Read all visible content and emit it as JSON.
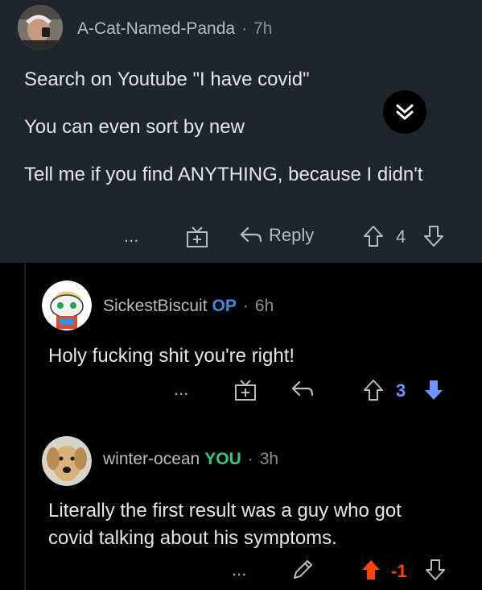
{
  "comments": [
    {
      "username": "A-Cat-Named-Panda",
      "separator": "·",
      "time": "7h",
      "paragraphs": [
        "Search on Youtube \"I have covid\"",
        "You can even sort by new",
        "Tell me if you find ANYTHING, because I didn't"
      ],
      "more_label": "...",
      "reply_label": "Reply",
      "score": "4"
    },
    {
      "username": "SickestBiscuit",
      "flair": "OP",
      "separator": "·",
      "time": "6h",
      "paragraphs": [
        "Holy fucking shit you're right!"
      ],
      "more_label": "...",
      "score": "3"
    },
    {
      "username": "winter-ocean",
      "flair": "YOU",
      "separator": "·",
      "time": "3h",
      "paragraphs": [
        "Literally the first result was a guy who got covid talking about his symptoms."
      ],
      "more_label": "...",
      "score": "-1"
    }
  ],
  "colors": {
    "top_card_bg": "#1f252d",
    "page_bg": "#000000",
    "op_color": "#3a8fe0",
    "you_color": "#37c878",
    "upvote_active": "#ff4500",
    "downvote_active": "#7193ff"
  },
  "icons": [
    "award-icon",
    "reply-arrow-icon",
    "upvote-icon",
    "downvote-icon",
    "edit-pencil-icon",
    "collapse-chevron-icon"
  ]
}
